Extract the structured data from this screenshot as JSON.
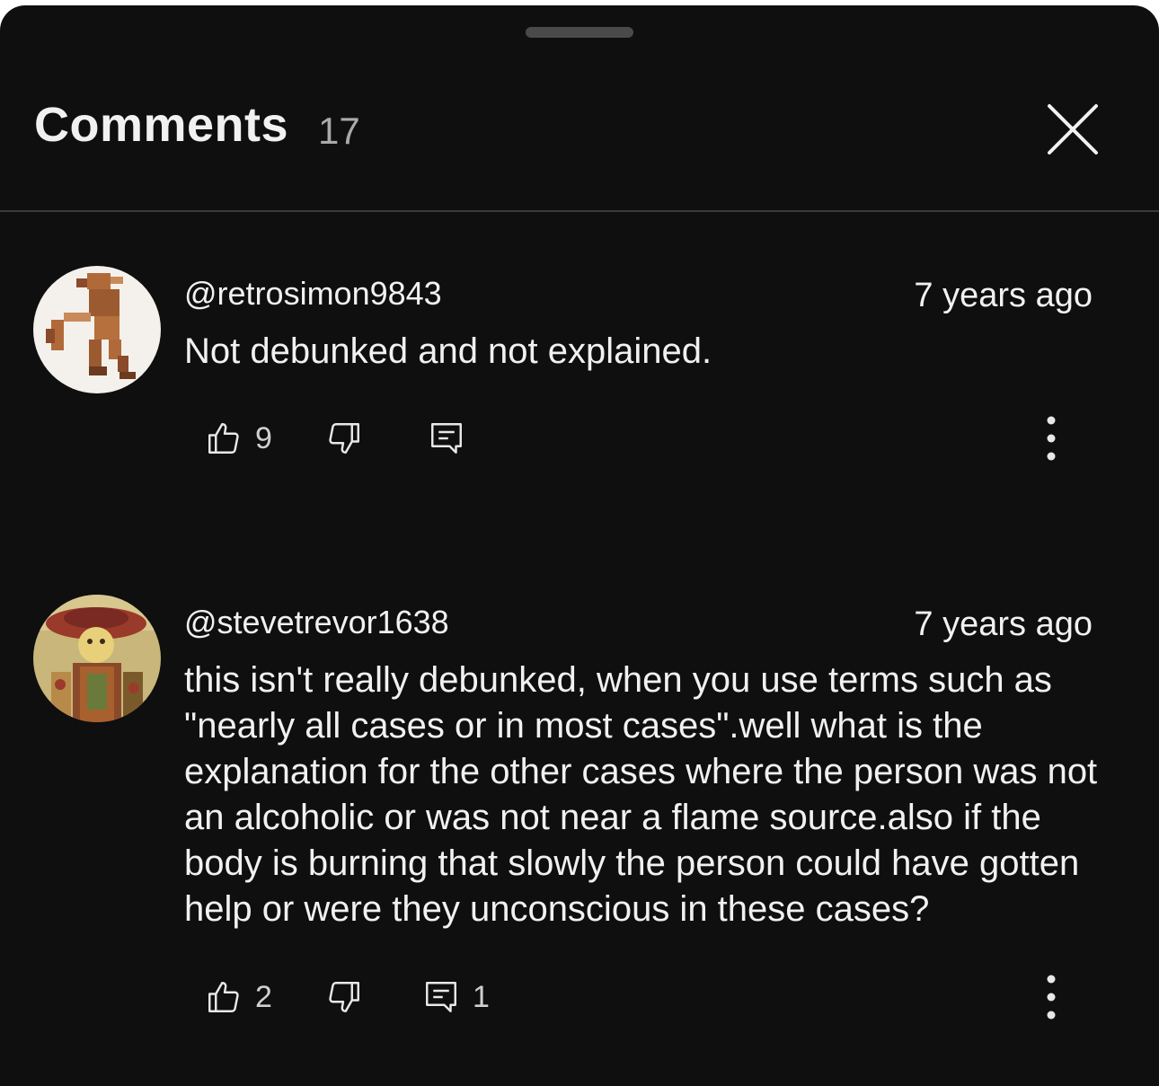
{
  "header": {
    "title": "Comments",
    "count": "17"
  },
  "comments": [
    {
      "author": "@retrosimon9843",
      "time": "7 years ago",
      "text": "Not debunked and not explained.",
      "likes": "9",
      "replies": ""
    },
    {
      "author": "@stevetrevor1638",
      "time": "7 years ago",
      "text": "this isn't really debunked, when you use terms such as \"nearly all cases or in most cases\".well what is the explanation for the other cases where the person was not an alcoholic or was not near a flame source.also if the body is burning that slowly the person could have gotten help or were they unconscious in these cases?",
      "likes": "2",
      "replies": "1"
    }
  ],
  "icons": {
    "like": "thumbs-up-icon",
    "dislike": "thumbs-down-icon",
    "reply": "reply-comment-icon",
    "more": "more-vertical-icon",
    "close": "close-icon"
  },
  "colors": {
    "background": "#0f0f0f",
    "text": "#f1f1f1",
    "muted": "#aaaaaa"
  }
}
